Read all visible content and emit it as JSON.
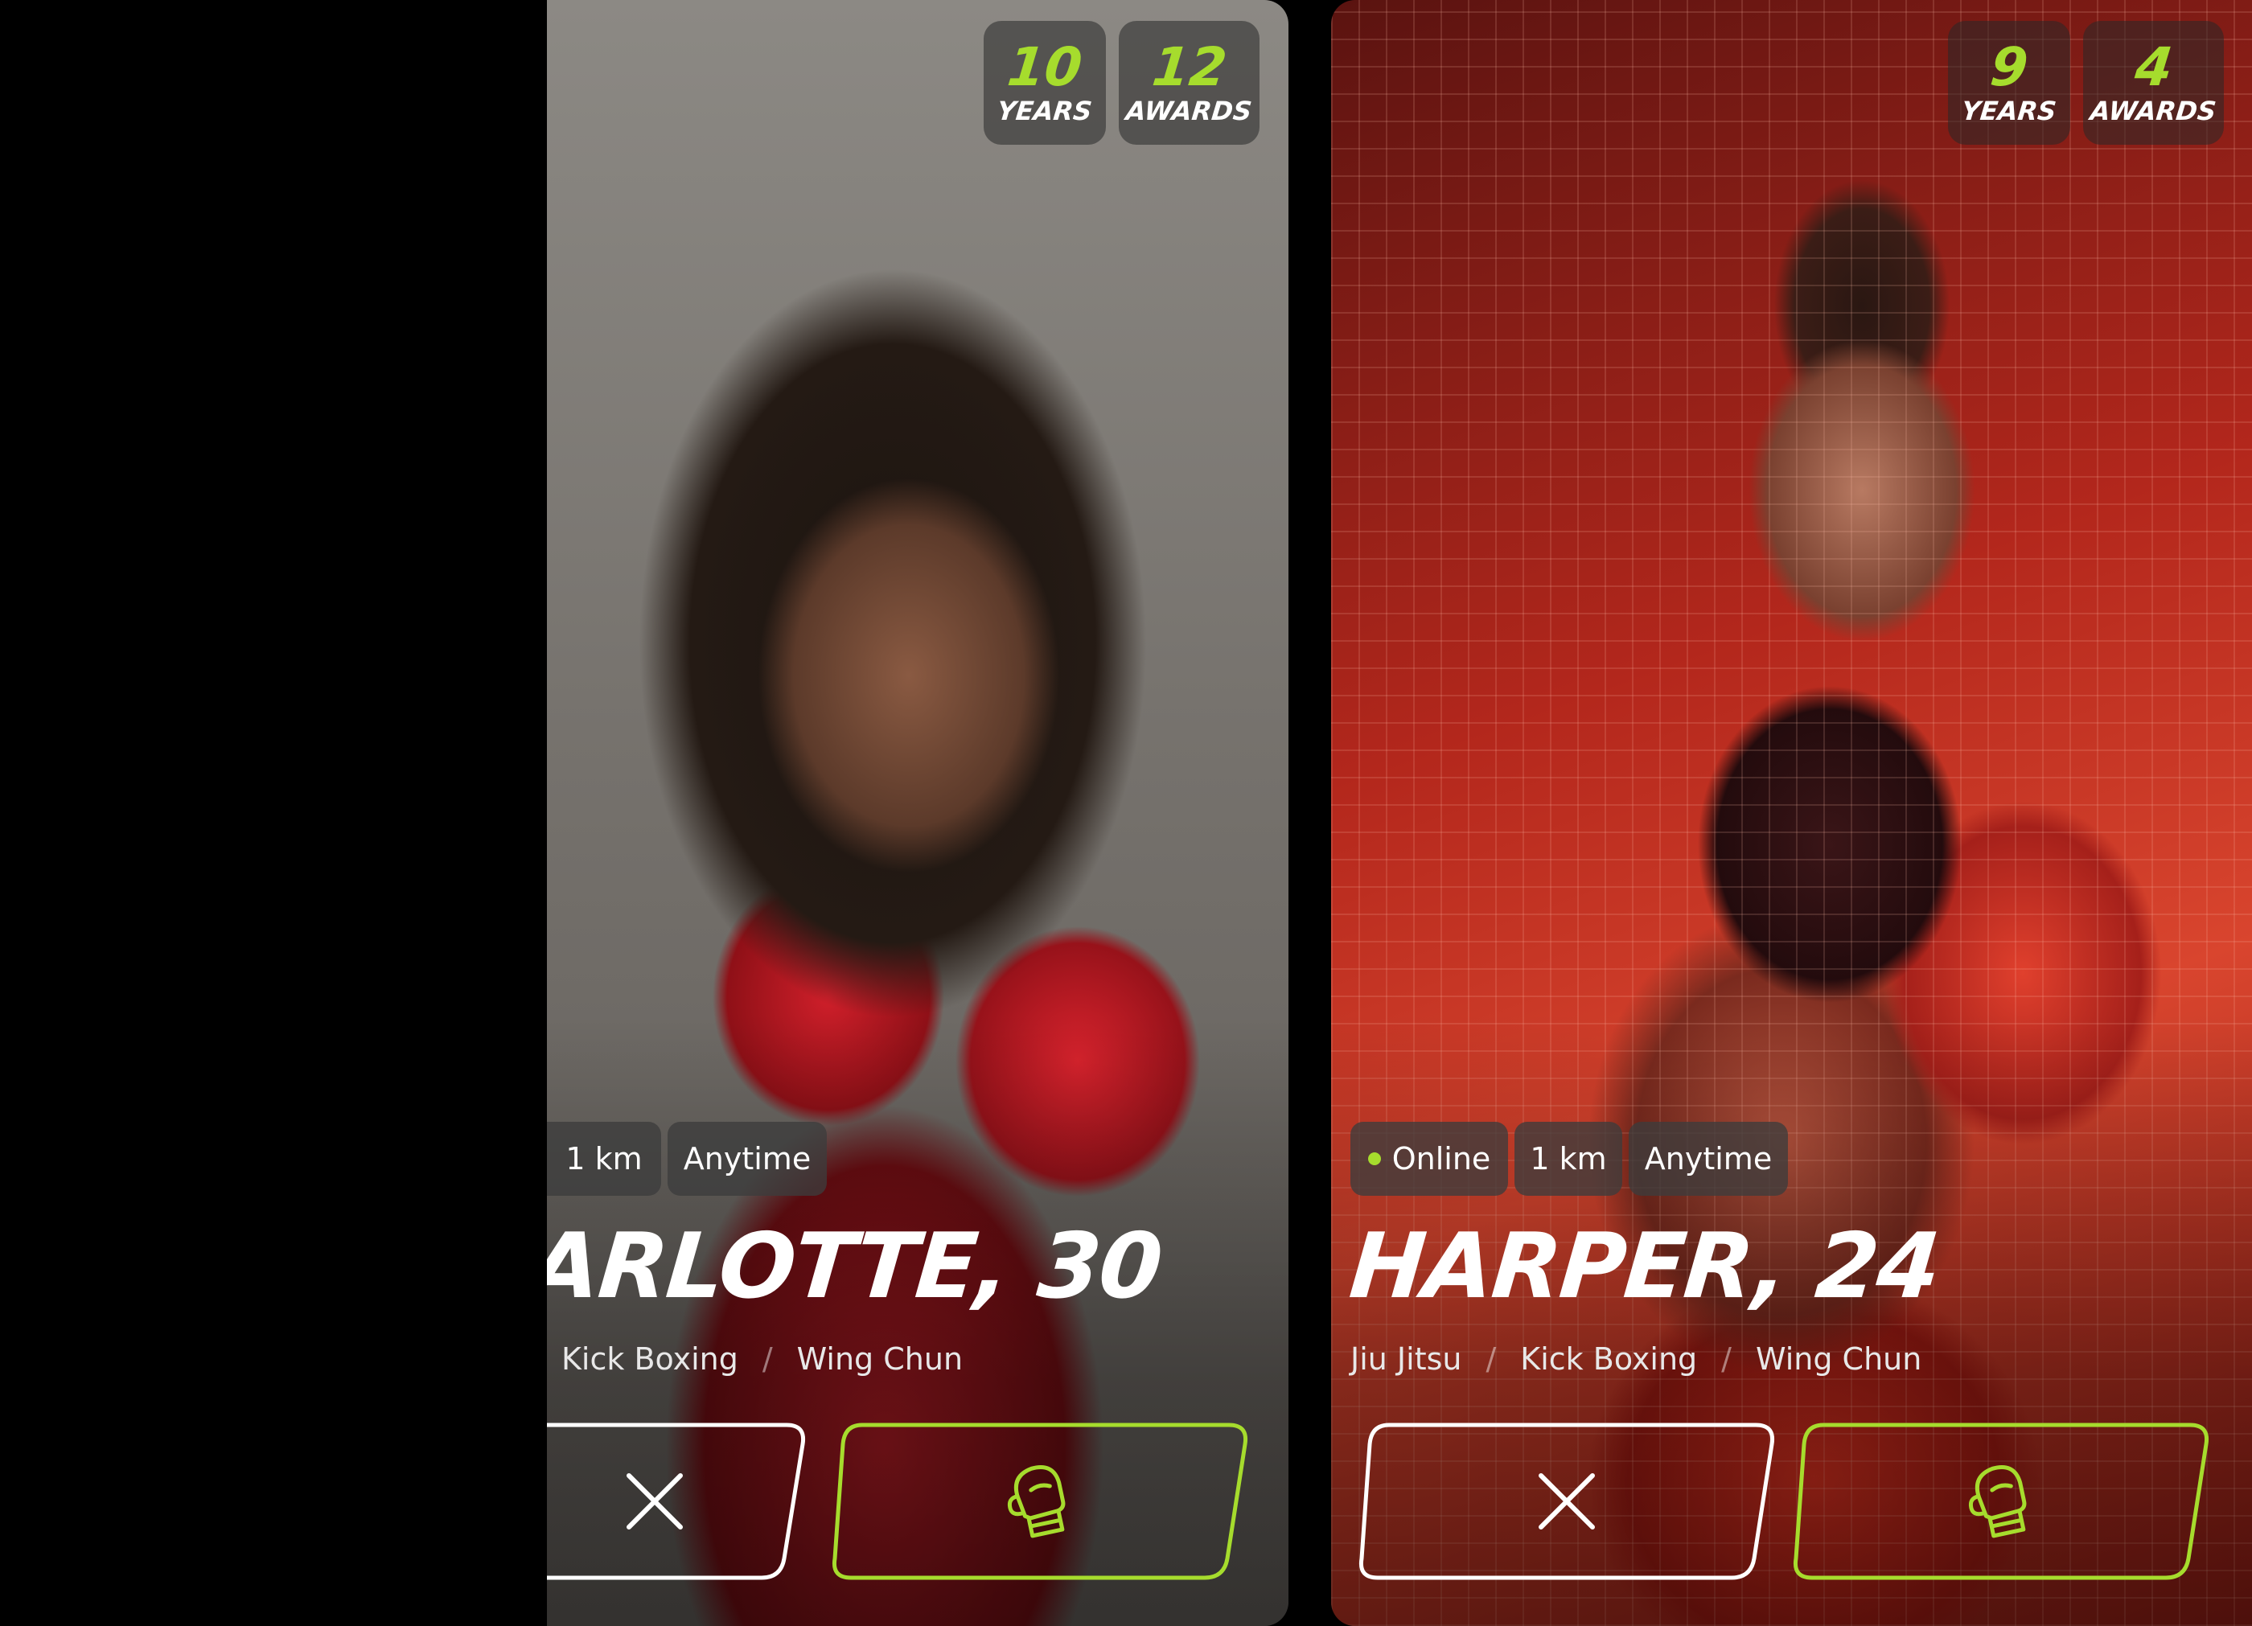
{
  "colors": {
    "accent": "#a6dc2d",
    "white": "#ffffff"
  },
  "cards": [
    {
      "stats": {
        "years_value": "10",
        "years_label": "YEARS",
        "awards_value": "12",
        "awards_label": "AWARDS"
      },
      "chips": [
        {
          "label": "1 km"
        },
        {
          "label": "Anytime"
        }
      ],
      "name": "ARLOTTE, 30",
      "disciplines": [
        "Kick Boxing",
        "Wing Chun"
      ],
      "separator": "/",
      "actions": {
        "dismiss_icon": "close-icon",
        "like_icon": "boxing-glove-icon"
      }
    },
    {
      "stats": {
        "years_value": "9",
        "years_label": "YEARS",
        "awards_value": "4",
        "awards_label": "AWARDS"
      },
      "status": {
        "label": "Online",
        "online": true
      },
      "chips": [
        {
          "label": "1 km"
        },
        {
          "label": "Anytime"
        }
      ],
      "name": "HARPER, 24",
      "disciplines": [
        "Jiu Jitsu",
        "Kick Boxing",
        "Wing Chun"
      ],
      "separator": "/",
      "actions": {
        "dismiss_icon": "close-icon",
        "like_icon": "boxing-glove-icon"
      }
    }
  ]
}
